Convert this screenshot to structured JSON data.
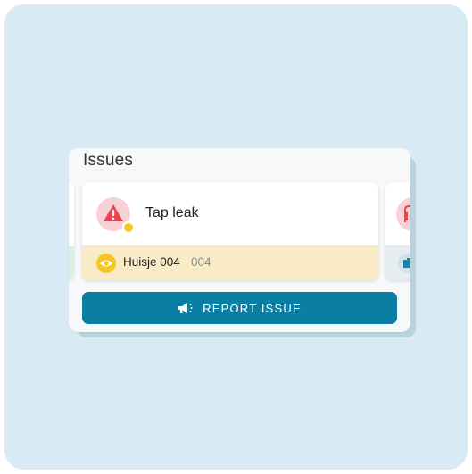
{
  "panel": {
    "title": "Issues"
  },
  "issue": {
    "title": "Tap leak",
    "severity_icon": "warning-triangle-icon",
    "status_color": "#f6c624",
    "location_name": "Huisje 004",
    "location_code": "004",
    "location_icon": "eye-icon"
  },
  "actions": {
    "report_label": "REPORT ISSUE",
    "report_icon": "megaphone-icon"
  },
  "colors": {
    "accent": "#0a7fa3",
    "warning": "#e8434f",
    "highlight": "#f9ebc8",
    "backdrop": "#d8ebf5"
  }
}
